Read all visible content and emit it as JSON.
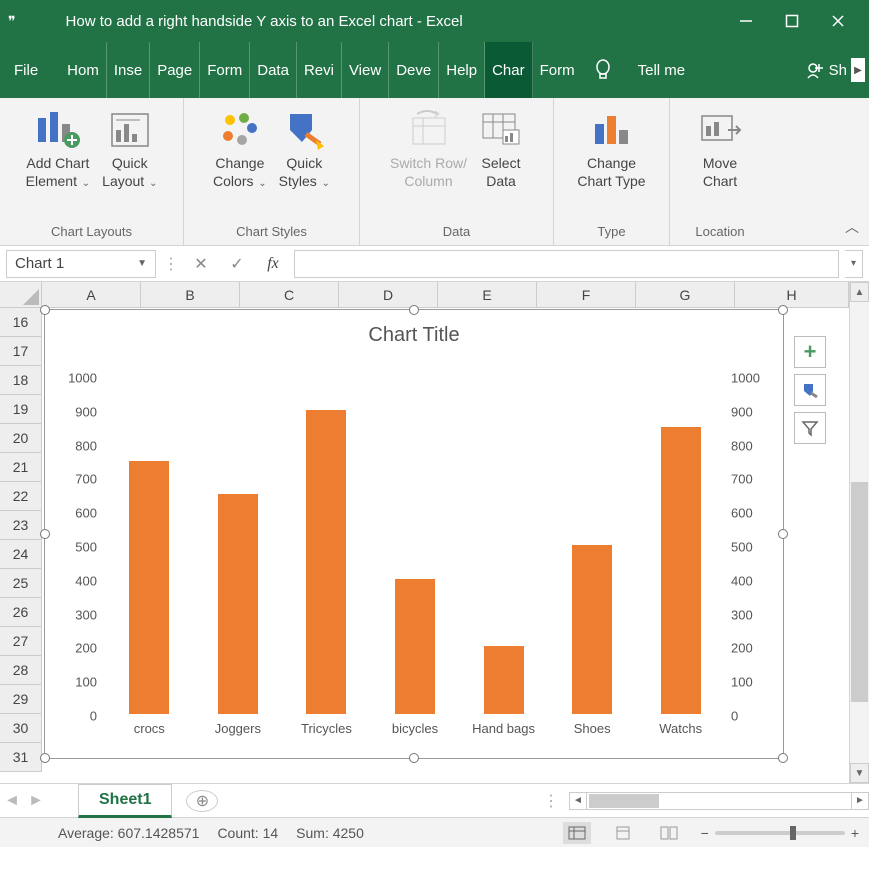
{
  "window": {
    "title": "How to add a right handside Y axis to an Excel chart  -  Excel"
  },
  "tabs": {
    "file": "File",
    "home": "Hom",
    "insert": "Inse",
    "page": "Page",
    "formulas": "Form",
    "data": "Data",
    "review": "Revi",
    "view": "View",
    "developer": "Deve",
    "help": "Help",
    "chart": "Char",
    "format": "Form",
    "tellme": "Tell me",
    "share": "Sh"
  },
  "ribbon": {
    "chart_layouts": {
      "label": "Chart Layouts",
      "add_chart_element": {
        "l1": "Add Chart",
        "l2": "Element"
      },
      "quick_layout": {
        "l1": "Quick",
        "l2": "Layout"
      }
    },
    "chart_styles": {
      "label": "Chart Styles",
      "change_colors": {
        "l1": "Change",
        "l2": "Colors"
      },
      "quick_styles": {
        "l1": "Quick",
        "l2": "Styles"
      }
    },
    "data": {
      "label": "Data",
      "switch": {
        "l1": "Switch Row/",
        "l2": "Column"
      },
      "select": {
        "l1": "Select",
        "l2": "Data"
      }
    },
    "type": {
      "label": "Type",
      "change": {
        "l1": "Change",
        "l2": "Chart Type"
      }
    },
    "location": {
      "label": "Location",
      "move": {
        "l1": "Move",
        "l2": "Chart"
      }
    }
  },
  "formula_bar": {
    "name": "Chart 1",
    "fx": "fx"
  },
  "columns": [
    "A",
    "B",
    "C",
    "D",
    "E",
    "F",
    "G",
    "H"
  ],
  "rows": [
    "16",
    "17",
    "18",
    "19",
    "20",
    "21",
    "22",
    "23",
    "24",
    "25",
    "26",
    "27",
    "28",
    "29",
    "30",
    "31"
  ],
  "chart_data": {
    "type": "bar",
    "title": "Chart Title",
    "categories": [
      "crocs",
      "Joggers",
      "Tricycles",
      "bicycles",
      "Hand bags",
      "Shoes",
      "Watchs"
    ],
    "values": [
      750,
      650,
      900,
      400,
      200,
      500,
      850
    ],
    "ylabel": "",
    "xlabel": "",
    "ylim": [
      0,
      1000
    ],
    "ticks": [
      0,
      100,
      200,
      300,
      400,
      500,
      600,
      700,
      800,
      900,
      1000
    ],
    "bar_color": "#ed7d31",
    "secondary_axis": true
  },
  "sheet": {
    "name": "Sheet1"
  },
  "status": {
    "average_label": "Average:",
    "average": "607.1428571",
    "count_label": "Count:",
    "count": "14",
    "sum_label": "Sum:",
    "sum": "4250"
  }
}
